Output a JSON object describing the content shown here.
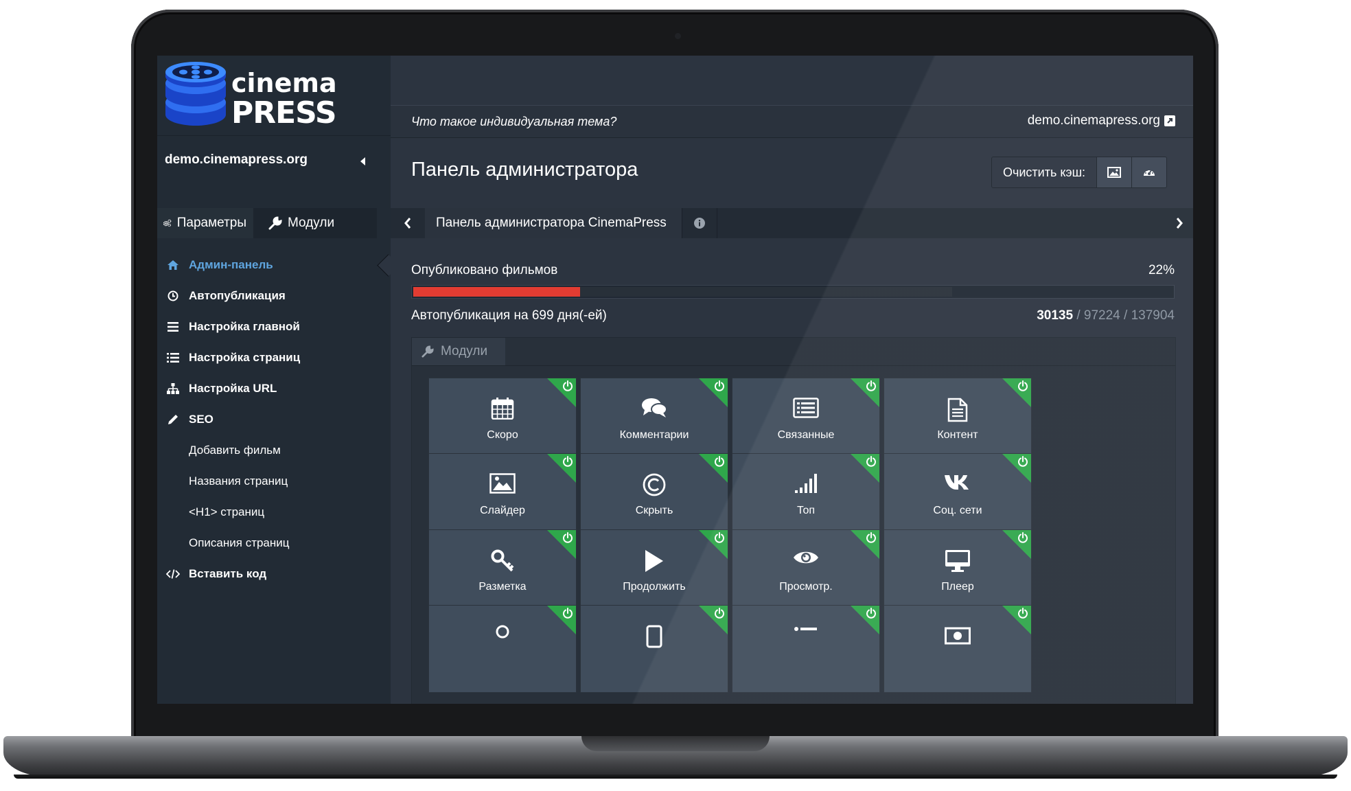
{
  "brand": {
    "line1": "cinema",
    "line2": "PRESS"
  },
  "sidebar": {
    "site": "demo.cinemapress.org",
    "tabs": [
      {
        "label": "Параметры",
        "icon": "gears-icon"
      },
      {
        "label": "Модули",
        "icon": "wrench-icon"
      }
    ],
    "items": [
      {
        "label": "Админ-панель",
        "icon": "home-icon",
        "active": true
      },
      {
        "label": "Автопубликация",
        "icon": "clock-icon"
      },
      {
        "label": "Настройка главной",
        "icon": "bars-icon"
      },
      {
        "label": "Настройка страниц",
        "icon": "list-icon"
      },
      {
        "label": "Настройка URL",
        "icon": "sitemap-icon"
      },
      {
        "label": "SEO",
        "icon": "pencil-icon"
      },
      {
        "label": "Добавить фильм",
        "sub": true
      },
      {
        "label": "Названия страниц",
        "sub": true
      },
      {
        "label": "<H1> страниц",
        "sub": true
      },
      {
        "label": "Описания страниц",
        "sub": true
      },
      {
        "label": "Вставить код",
        "icon": "code-icon"
      }
    ]
  },
  "topbar": {
    "question": "Что такое индивидуальная тема?",
    "domain": "demo.cinemapress.org"
  },
  "header": {
    "title": "Панель администратора",
    "cache_label": "Очистить кэш:"
  },
  "tabbar": {
    "tab_label": "Панель администратора CinemaPress"
  },
  "stats": {
    "published_label": "Опубликовано фильмов",
    "published_percent": "22%",
    "published_fraction": 0.22,
    "published_of_available_fraction": 0.71,
    "auto_label": "Автопубликация на 699 дня(-ей)",
    "count_published": "30135",
    "count_rest": " / 97224 / 137904"
  },
  "modules": {
    "tab_label": "Модули",
    "tiles": [
      {
        "label": "Скоро",
        "icon": "calendar-icon"
      },
      {
        "label": "Комментарии",
        "icon": "comments-icon"
      },
      {
        "label": "Связанные",
        "icon": "list-alt-icon"
      },
      {
        "label": "Контент",
        "icon": "file-text-icon"
      },
      {
        "label": "Слайдер",
        "icon": "picture-icon"
      },
      {
        "label": "Скрыть",
        "icon": "copyright-icon"
      },
      {
        "label": "Топ",
        "icon": "signal-icon"
      },
      {
        "label": "Соц. сети",
        "icon": "vk-icon"
      },
      {
        "label": "Разметка",
        "icon": "key-icon"
      },
      {
        "label": "Продолжить",
        "icon": "play-icon"
      },
      {
        "label": "Просмотр.",
        "icon": "eye-icon"
      },
      {
        "label": "Плеер",
        "icon": "desktop-icon"
      },
      {
        "label": "",
        "icon": "user-icon"
      },
      {
        "label": "",
        "icon": "tablet-icon"
      },
      {
        "label": "",
        "icon": "list-ul-icon"
      },
      {
        "label": "",
        "icon": "money-icon"
      }
    ]
  },
  "colors": {
    "accent": "#5fa5df",
    "progress": "#e23c32",
    "module_on": "#2fa74b",
    "tile_bg": "#404d5c",
    "sidebar_bg": "#222b35"
  }
}
